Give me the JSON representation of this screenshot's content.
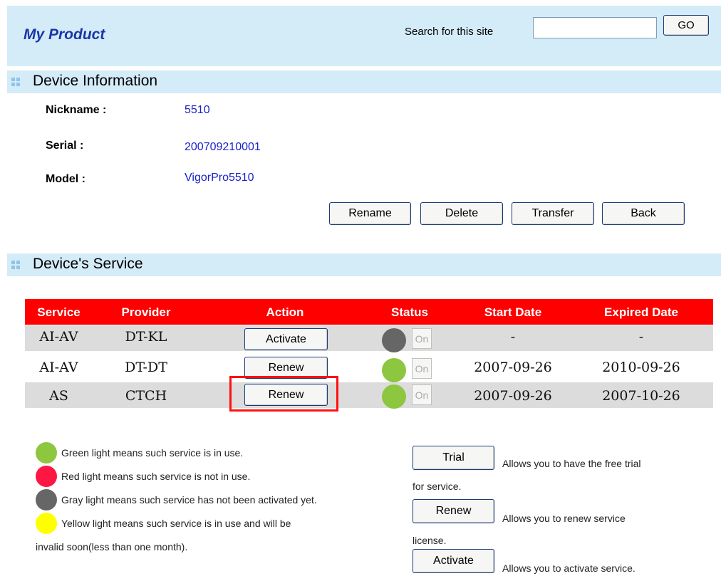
{
  "header": {
    "title": "My Product",
    "search_label": "Search for this site",
    "search_value": "",
    "go_label": "GO"
  },
  "device_info": {
    "section_title": "Device Information",
    "fields": [
      {
        "label": "Nickname :",
        "value": "5510"
      },
      {
        "label": "Serial :",
        "value": "200709210001"
      },
      {
        "label": "Model :",
        "value": "VigorPro5510"
      }
    ],
    "buttons": [
      "Rename",
      "Delete",
      "Transfer",
      "Back"
    ]
  },
  "device_service": {
    "section_title": "Device's Service",
    "columns": [
      "Service",
      "Provider",
      "Action",
      "Status",
      "Start Date",
      "Expired Date"
    ],
    "rows": [
      {
        "service": "AI-AV",
        "provider": "DT-KL",
        "action": "Activate",
        "status_color": "#666666",
        "status_label": "On",
        "start": "-",
        "expired": "-"
      },
      {
        "service": "AI-AV",
        "provider": "DT-DT",
        "action": "Renew",
        "status_color": "#8dc63f",
        "status_label": "On",
        "start": "2007-09-26",
        "expired": "2010-09-26"
      },
      {
        "service": "AS",
        "provider": "CTCH",
        "action": "Renew",
        "status_color": "#8dc63f",
        "status_label": "On",
        "start": "2007-09-26",
        "expired": "2007-10-26"
      }
    ]
  },
  "legend": {
    "green": {
      "color": "#8dc63f",
      "text": "Green light means such service is in use."
    },
    "red": {
      "color": "#ff1744",
      "text": "Red light means such service is not in use."
    },
    "gray": {
      "color": "#666666",
      "text": "Gray light means such service has not been activated yet."
    },
    "yellow": {
      "color": "#ffff00",
      "text": "Yellow light means such service is in use and will be",
      "text_cont": "invalid soon(less than one month)."
    }
  },
  "help": {
    "trial": {
      "button": "Trial",
      "text": "Allows you to have the free trial",
      "text_cont": "for service."
    },
    "renew": {
      "button": "Renew",
      "text": "Allows you to renew service",
      "text_cont": "license."
    },
    "activate": {
      "button": "Activate",
      "text": "Allows you to activate service."
    }
  },
  "colors": {
    "header_bg": "#d4ebf8",
    "title": "#1a36a8",
    "table_header": "#ff0000",
    "link_value": "#1a22c8",
    "highlight": "#ff1010"
  }
}
